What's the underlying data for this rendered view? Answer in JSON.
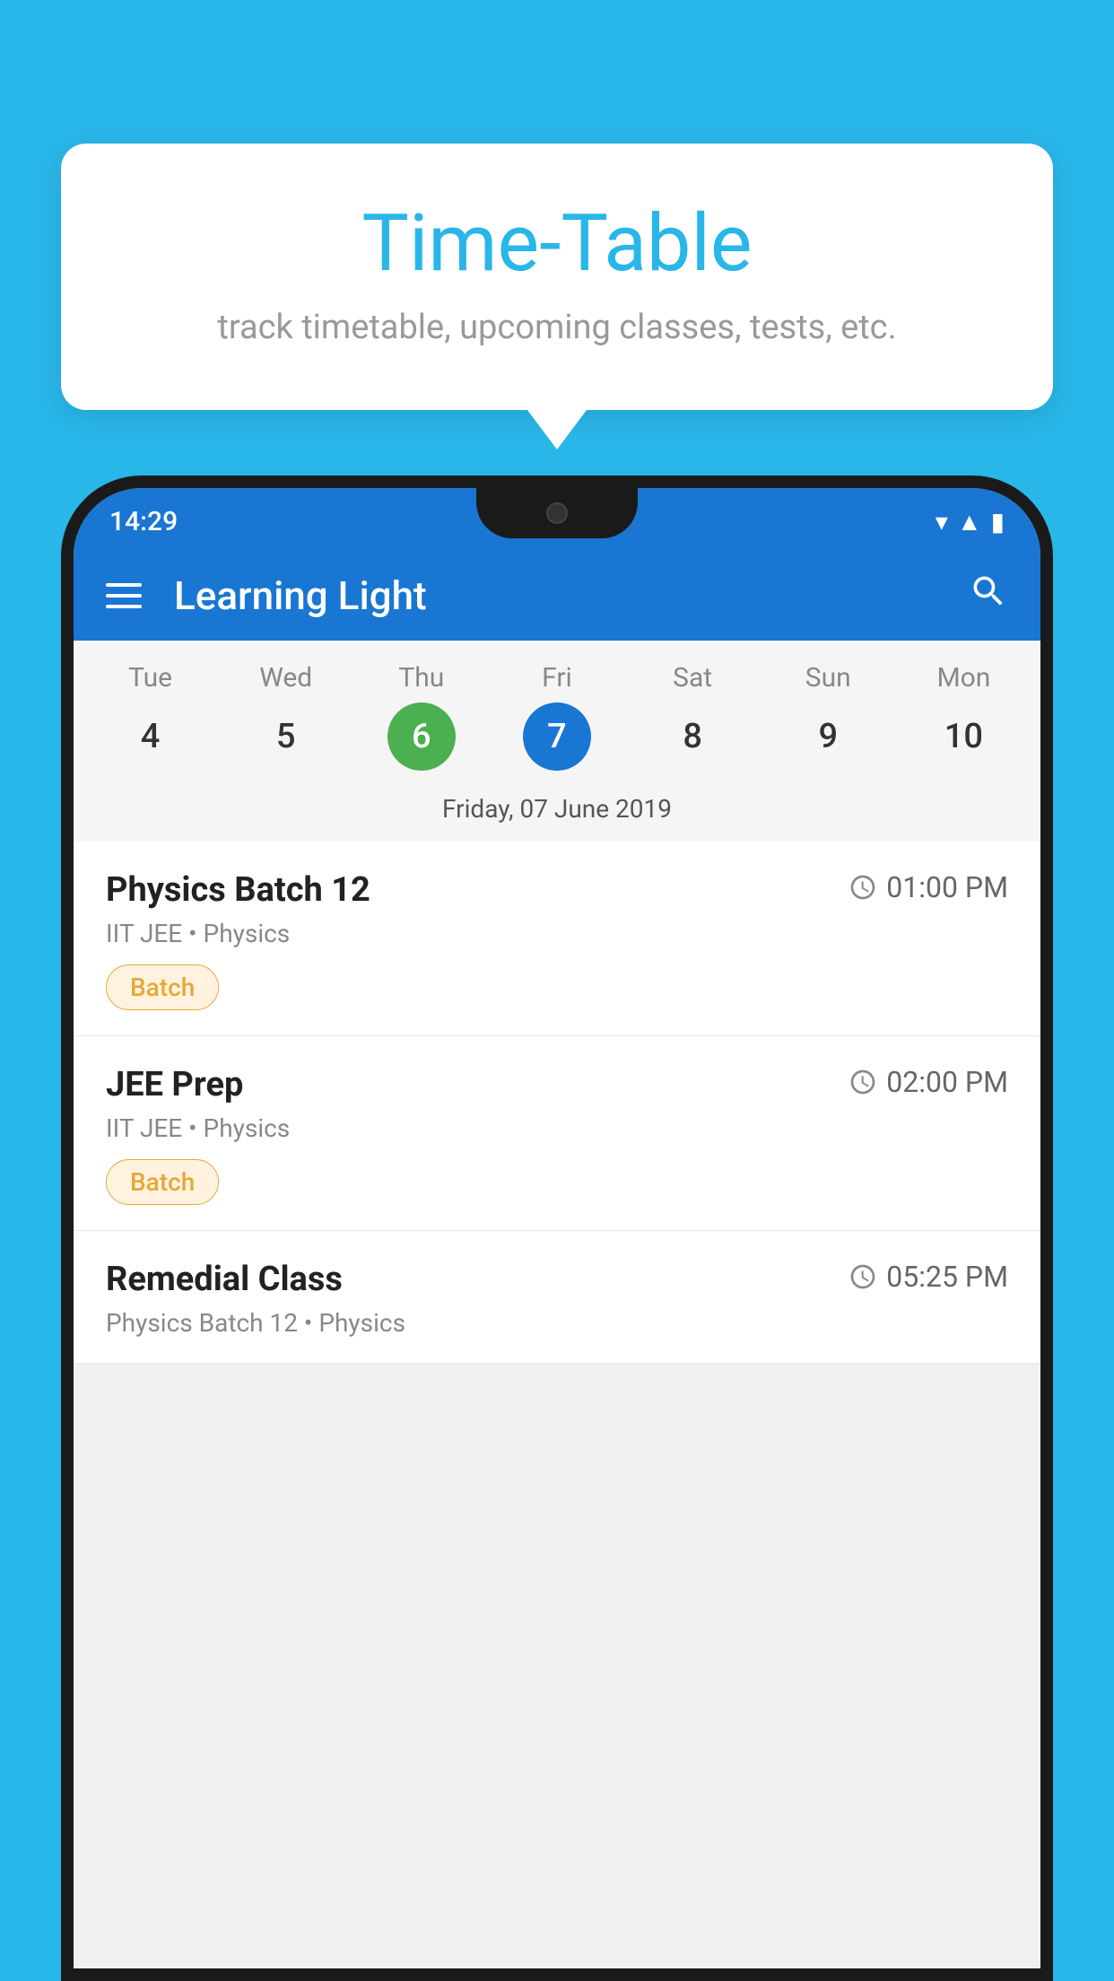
{
  "background": {
    "color": "#29B6E8"
  },
  "tooltip": {
    "title": "Time-Table",
    "subtitle": "track timetable, upcoming classes, tests, etc."
  },
  "phone": {
    "status_bar": {
      "time": "14:29"
    },
    "app_bar": {
      "title": "Learning Light"
    },
    "calendar": {
      "days": [
        {
          "label": "Tue",
          "number": "4",
          "state": "normal"
        },
        {
          "label": "Wed",
          "number": "5",
          "state": "normal"
        },
        {
          "label": "Thu",
          "number": "6",
          "state": "today"
        },
        {
          "label": "Fri",
          "number": "7",
          "state": "selected"
        },
        {
          "label": "Sat",
          "number": "8",
          "state": "normal"
        },
        {
          "label": "Sun",
          "number": "9",
          "state": "normal"
        },
        {
          "label": "Mon",
          "number": "10",
          "state": "normal"
        }
      ],
      "selected_date": "Friday, 07 June 2019"
    },
    "schedule": [
      {
        "name": "Physics Batch 12",
        "time": "01:00 PM",
        "details": "IIT JEE • Physics",
        "badge": "Batch"
      },
      {
        "name": "JEE Prep",
        "time": "02:00 PM",
        "details": "IIT JEE • Physics",
        "badge": "Batch"
      },
      {
        "name": "Remedial Class",
        "time": "05:25 PM",
        "details": "Physics Batch 12 • Physics",
        "badge": null
      }
    ]
  }
}
